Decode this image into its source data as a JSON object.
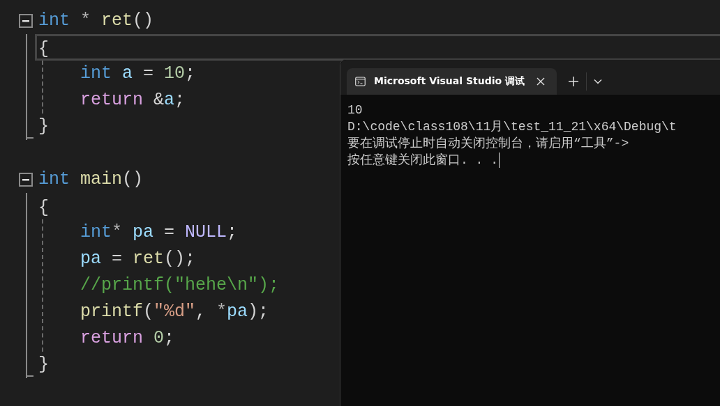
{
  "editor": {
    "functions": [
      {
        "expanded": true,
        "header": [
          {
            "kind": "keyword",
            "text": "int"
          },
          {
            "kind": "operator",
            "text": " * "
          },
          {
            "kind": "function",
            "text": "ret"
          },
          {
            "kind": "punct",
            "text": "()"
          }
        ],
        "open_brace": "{",
        "open_brace_current": true,
        "body": [
          [
            {
              "kind": "keyword",
              "text": "int"
            },
            {
              "kind": "variable",
              "text": " a"
            },
            {
              "kind": "punct",
              "text": " = "
            },
            {
              "kind": "number",
              "text": "10"
            },
            {
              "kind": "punct",
              "text": ";"
            }
          ],
          [
            {
              "kind": "control",
              "text": "return"
            },
            {
              "kind": "punct",
              "text": " &"
            },
            {
              "kind": "variable",
              "text": "a"
            },
            {
              "kind": "punct",
              "text": ";"
            }
          ]
        ],
        "close_brace": "}"
      },
      {
        "expanded": true,
        "header": [
          {
            "kind": "keyword",
            "text": "int"
          },
          {
            "kind": "function",
            "text": " main"
          },
          {
            "kind": "punct",
            "text": "()"
          }
        ],
        "open_brace": "{",
        "open_brace_current": false,
        "body": [
          [
            {
              "kind": "keyword",
              "text": "int"
            },
            {
              "kind": "operator",
              "text": "* "
            },
            {
              "kind": "variable",
              "text": "pa"
            },
            {
              "kind": "punct",
              "text": " = "
            },
            {
              "kind": "macro",
              "text": "NULL"
            },
            {
              "kind": "punct",
              "text": ";"
            }
          ],
          [
            {
              "kind": "variable",
              "text": "pa"
            },
            {
              "kind": "punct",
              "text": " = "
            },
            {
              "kind": "function",
              "text": "ret"
            },
            {
              "kind": "punct",
              "text": "();"
            }
          ],
          [
            {
              "kind": "comment",
              "text": "//printf(\"hehe\\n\");"
            }
          ],
          [
            {
              "kind": "function",
              "text": "printf"
            },
            {
              "kind": "punct",
              "text": "("
            },
            {
              "kind": "string",
              "text": "\"%d\""
            },
            {
              "kind": "punct",
              "text": ", "
            },
            {
              "kind": "operator",
              "text": "*"
            },
            {
              "kind": "variable",
              "text": "pa"
            },
            {
              "kind": "punct",
              "text": ");"
            }
          ],
          [
            {
              "kind": "control",
              "text": "return"
            },
            {
              "kind": "number",
              "text": " 0"
            },
            {
              "kind": "punct",
              "text": ";"
            }
          ]
        ],
        "close_brace": "}"
      }
    ]
  },
  "terminal": {
    "tabs": [
      {
        "title": "Microsoft Visual Studio 调试",
        "selected": true
      }
    ],
    "output": [
      "10",
      "D:\\code\\class108\\11月\\test_11_21\\x64\\Debug\\t",
      "要在调试停止时自动关闭控制台，请启用“工具”->",
      "按任意键关闭此窗口. . ."
    ]
  }
}
